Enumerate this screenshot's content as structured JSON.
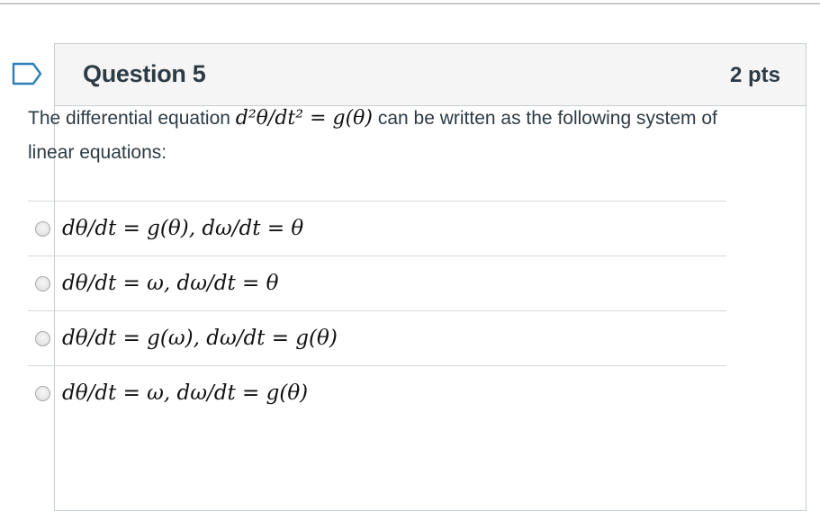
{
  "question": {
    "title": "Question 5",
    "points": "2 pts",
    "text_before": "The differential equation ",
    "equation": "d²θ/dt² = g(θ)",
    "text_after": " can be written as the following system of linear equations:"
  },
  "answers": [
    {
      "label": "dθ/dt = g(θ), dω/dt = θ",
      "selected": false
    },
    {
      "label": "dθ/dt = ω, dω/dt = θ",
      "selected": false
    },
    {
      "label": "dθ/dt = g(ω), dω/dt = g(θ)",
      "selected": false
    },
    {
      "label": "dθ/dt = ω, dω/dt = g(θ)",
      "selected": false
    }
  ],
  "icons": {
    "flag": "bookmark-flag-icon",
    "flag_color": "#2d7fb8"
  },
  "colors": {
    "text": "#2d3b45",
    "header_bg": "#f5f5f5",
    "border": "#c7cdd1"
  }
}
